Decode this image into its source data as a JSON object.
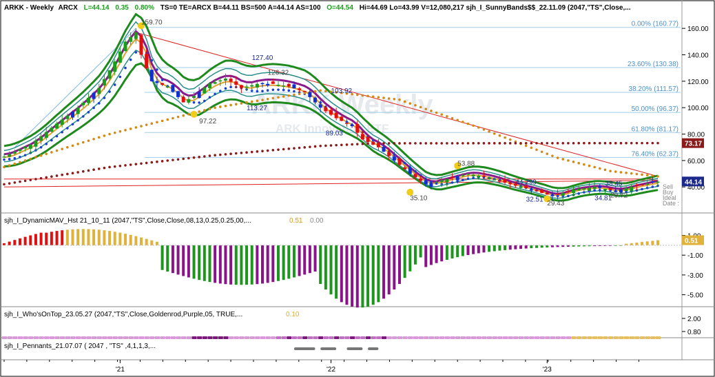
{
  "header": {
    "symbol": "ARKK - Weekly",
    "exchange": "ARCX",
    "last": "L=44.14",
    "change": "0.35",
    "change_pct": "0.80%",
    "rest": "TS=0  TE=ARCX  B=44.11  BS=500  A=44.14  AS=100",
    "open": "O=44.54",
    "hilo": "Hi=44.69  Lo=43.99  V=12,080,217  sjh_I_SunnyBands$$_22.11.09 (2047,\"TS\",Close,..."
  },
  "watermark": {
    "title": "ARKK Weekly",
    "subtitle": "ARK Innovation ETF"
  },
  "colors": {
    "up": "#1a9d1a",
    "down": "#e01010",
    "blue_bar": "#1030d0",
    "band_green": "#1e8a1e",
    "band_teal": "#2a8f8a",
    "band_purple": "#8a1a8a",
    "band_orange": "#e0a030",
    "dot_blue": "#1c3fd0",
    "dot_orange": "#d48a12",
    "dot_maroon": "#8b1a1a",
    "fib": "#9fcde8",
    "hist_green": "#1c961c",
    "hist_purple": "#8a138a",
    "hist_gold": "#e0b23c"
  },
  "chart_data": [
    {
      "type": "candlestick",
      "title": "ARKK - Weekly",
      "x_ticks": [
        "'21",
        "'22",
        "'23"
      ],
      "ylim": [
        25,
        170
      ],
      "yticks": [
        "160.00",
        "140.00",
        "120.00",
        "100.00",
        "80.00",
        "60.00",
        "40.00"
      ],
      "last_price": "44.14",
      "maroon_level": "73.17",
      "price_path": [
        [
          0,
          63
        ],
        [
          5,
          72
        ],
        [
          10,
          88
        ],
        [
          14,
          100
        ],
        [
          18,
          115
        ],
        [
          21,
          135
        ],
        [
          23,
          150
        ],
        [
          25,
          157
        ],
        [
          26,
          140
        ],
        [
          28,
          120
        ],
        [
          31,
          116
        ],
        [
          34,
          104
        ],
        [
          36,
          109
        ],
        [
          39,
          118
        ],
        [
          42,
          122
        ],
        [
          45,
          115
        ],
        [
          48,
          118
        ],
        [
          51,
          118
        ],
        [
          54,
          116
        ],
        [
          57,
          112
        ],
        [
          60,
          100
        ],
        [
          63,
          92
        ],
        [
          66,
          86
        ],
        [
          68,
          76
        ],
        [
          71,
          70
        ],
        [
          74,
          60
        ],
        [
          77,
          50
        ],
        [
          80,
          42
        ],
        [
          84,
          46
        ],
        [
          88,
          50
        ],
        [
          92,
          47
        ],
        [
          96,
          42
        ],
        [
          100,
          38
        ],
        [
          104,
          33
        ],
        [
          108,
          38
        ],
        [
          112,
          40
        ],
        [
          116,
          37
        ],
        [
          120,
          41
        ],
        [
          124,
          44
        ]
      ],
      "fib_levels": [
        {
          "label": "0.00% (160.77)",
          "value": 160.77
        },
        {
          "label": "23.60% (130.38)",
          "value": 130.38
        },
        {
          "label": "38.20% (111.57)",
          "value": 111.57
        },
        {
          "label": "50.00% (96.37)",
          "value": 96.37
        },
        {
          "label": "61.80% (81.17)",
          "value": 81.17
        },
        {
          "label": "76.40% (62.37)",
          "value": 62.37
        }
      ],
      "annotations": [
        {
          "text": "159.70",
          "x": 26,
          "y": 163,
          "style": "ann"
        },
        {
          "text": "97.22",
          "x": 37,
          "y": 88,
          "style": "ann"
        },
        {
          "text": "127.40",
          "x": 47,
          "y": 136,
          "style": "ann-blue"
        },
        {
          "text": "126.32",
          "x": 50,
          "y": 125,
          "style": "ann"
        },
        {
          "text": "113.27",
          "x": 46,
          "y": 98,
          "style": "ann-blue"
        },
        {
          "text": "103.92",
          "x": 62,
          "y": 111,
          "style": "ann-blue"
        },
        {
          "text": "89.03",
          "x": 61,
          "y": 79,
          "style": "ann-blue"
        },
        {
          "text": "53.88",
          "x": 86,
          "y": 56,
          "style": "ann"
        },
        {
          "text": "35.10",
          "x": 77,
          "y": 30,
          "style": "ann"
        },
        {
          "text": "44.299",
          "x": 97,
          "y": 42,
          "style": "ann-blue"
        },
        {
          "text": "32.51",
          "x": 99,
          "y": 29,
          "style": "ann-blue"
        },
        {
          "text": "29.43",
          "x": 103,
          "y": 26,
          "style": "ann"
        },
        {
          "text": "34.81",
          "x": 112,
          "y": 30,
          "style": "ann-blue"
        },
        {
          "text": "29.72",
          "x": 115,
          "y": 32,
          "style": "ann"
        },
        {
          "text": "38.45",
          "x": 114,
          "y": 41,
          "style": "ann-blue"
        }
      ],
      "side_labels": [
        "Date :",
        "Ideal",
        "Buy",
        "Sell"
      ]
    },
    {
      "type": "bar",
      "title": "sjh_I_DynamicMAV_Hst 21_10_11 (2047,\"TS\",Close,Close,08,13,0.25,0.25,00,...",
      "values_text": [
        "0.51",
        "0.00"
      ],
      "yticks": [
        "1.00",
        "-1.00",
        "-3.00",
        "-5.00"
      ],
      "last_value": "0.51",
      "ylim": [
        -6,
        1.8
      ]
    },
    {
      "type": "line",
      "title": "sjh_I_Who'sOnTop_23.05.27 (2047,\"TS\",Close,Goldenrod,Purple,05,  TRUE,...",
      "values_text": [
        "0.10"
      ],
      "yticks": [
        "2.00",
        "0.80"
      ]
    },
    {
      "type": "bar",
      "title": "sjh_I_Pennants_21.07.07 ( 2047 , \"TS\" ,4,1,1,3,..."
    }
  ]
}
